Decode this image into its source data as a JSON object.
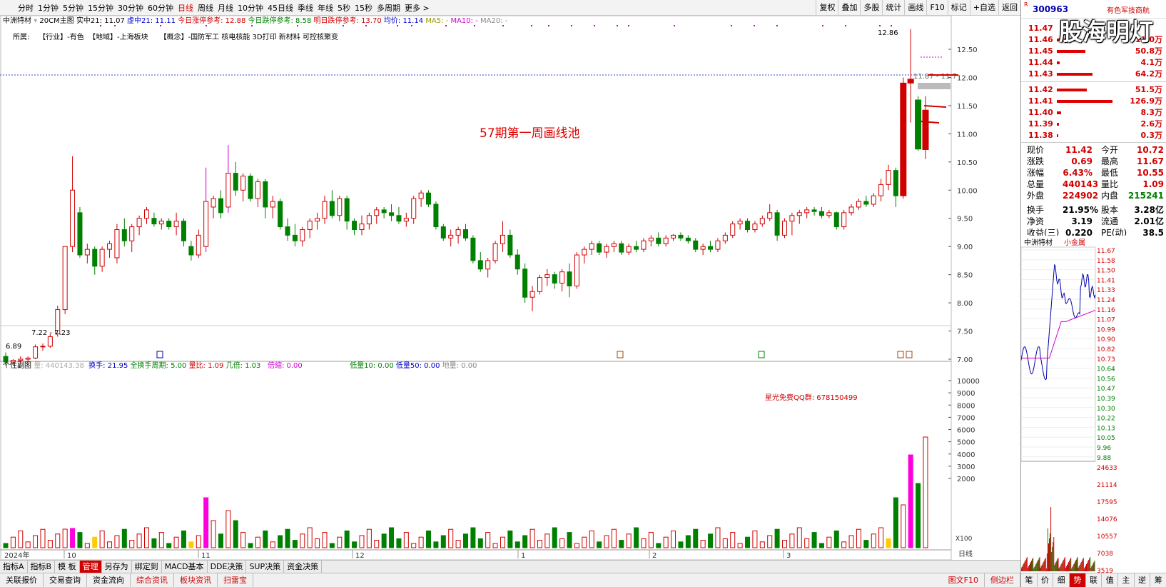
{
  "toolbar": {
    "periods": [
      "分时",
      "1分钟",
      "5分钟",
      "15分钟",
      "30分钟",
      "60分钟",
      "日线",
      "周线",
      "月线",
      "10分钟",
      "45日线",
      "季线",
      "年线",
      "5秒",
      "15秒",
      "多周期",
      "更多 >"
    ],
    "active_period": "日线",
    "tools": [
      "复权",
      "叠加",
      "多股",
      "统计",
      "画线",
      "F10",
      "标记",
      "+自选",
      "返回"
    ]
  },
  "stock": {
    "name": "中洲特材",
    "code": "300963",
    "subtitle": "有色军技商航",
    "board": "20CM主图"
  },
  "info": {
    "realtime": "实中21: 11.07",
    "virtual": "虚中21: 11.11",
    "limit_up_ref": "今日涨停参考: 12.88",
    "limit_down_ref": "今日跌停参考: 8.58",
    "tomorrow_ref": "明日跌停参考: 13.70",
    "avg": "均价: 11.14",
    "ma5": "MA5: -",
    "ma10": "MA10: -",
    "ma20": "MA20: -"
  },
  "tags": {
    "prefix": "所属:",
    "industry": "【行业】-有色",
    "region": "【地域】-上海板块",
    "concept": "【概念】-国防军工 核电核能 3D打印 新材料 可控核聚变"
  },
  "annotation": "57期第一周画线池",
  "chart_labels": {
    "high_label": "12.86",
    "low_label": "6.89",
    "range_label": "7.22 - 7.23",
    "current_label": "11.87 - 11.7"
  },
  "price_axis": [
    "12.50",
    "12.00",
    "11.50",
    "11.00",
    "10.50",
    "10.00",
    "9.50",
    "9.00",
    "8.50",
    "8.00",
    "7.50",
    "7.00"
  ],
  "volume_axis": [
    "10000",
    "9000",
    "8000",
    "7000",
    "6000",
    "5000",
    "4000",
    "3000",
    "2000"
  ],
  "sub_header": {
    "title": "个性副图",
    "vol": "量: 440143.38",
    "hs": "换手: 21.95",
    "qhs": "全换手周期: 5.00",
    "lb": "量比: 1.09",
    "jb": "几倍: 1.03",
    "bj": "倍缩: 0.00",
    "dl10": "低量10: 0.00",
    "dl50": "低量50: 0.00",
    "dil": "地量: 0.00"
  },
  "qq_text": "星光免费QQ群: 678150499",
  "x_axis": {
    "year": "2024年",
    "months": [
      "10",
      "11",
      "12",
      "1",
      "2",
      "3"
    ],
    "zoom": "X100",
    "unit": "日线"
  },
  "bottom_tabs": [
    "指标A",
    "指标B",
    "模 板",
    "管理",
    "另存为",
    "绑定到",
    "MACD基本",
    "DDE决策",
    "SUP决策",
    "资金决策"
  ],
  "bottom_tabs_active": "管理",
  "status": [
    "关联报价",
    "交易查询",
    "资金流向",
    "综合资讯",
    "板块资讯",
    "扫雷宝"
  ],
  "status_right": [
    "图文F10",
    "侧边栏"
  ],
  "orderbook": {
    "asks": [
      {
        "p": "11.47",
        "v": "",
        "w": 0
      },
      {
        "p": "11.46",
        "v": "11.0万",
        "w": 30
      },
      {
        "p": "11.45",
        "v": "50.8万",
        "w": 40
      },
      {
        "p": "11.44",
        "v": "4.1万",
        "w": 4
      },
      {
        "p": "11.43",
        "v": "64.2万",
        "w": 50
      }
    ],
    "bids": [
      {
        "p": "11.42",
        "v": "51.5万",
        "w": 42
      },
      {
        "p": "11.41",
        "v": "126.9万",
        "w": 78
      },
      {
        "p": "11.40",
        "v": "8.3万",
        "w": 6
      },
      {
        "p": "11.39",
        "v": "2.6万",
        "w": 3
      },
      {
        "p": "11.38",
        "v": "0.3万",
        "w": 2
      }
    ]
  },
  "quote": [
    [
      "现价",
      "11.42",
      "red",
      "今开",
      "10.72",
      "red"
    ],
    [
      "涨跌",
      "0.69",
      "red",
      "最高",
      "11.67",
      "red"
    ],
    [
      "涨幅",
      "6.43%",
      "red",
      "最低",
      "10.55",
      "red"
    ],
    [
      "总量",
      "440143",
      "red",
      "量比",
      "1.09",
      "red"
    ],
    [
      "外盘",
      "224902",
      "red",
      "内盘",
      "215241",
      "green"
    ],
    [
      "换手",
      "21.95%",
      "blk",
      "股本",
      "3.28亿",
      "blk"
    ],
    [
      "净资",
      "3.19",
      "blk",
      "流通",
      "2.01亿",
      "blk"
    ],
    [
      "收益(三)",
      "0.220",
      "blk",
      "PE(动)",
      "38.5",
      "blk"
    ]
  ],
  "mini_title": "小金属",
  "mini_axis": [
    "11.67",
    "11.58",
    "11.50",
    "11.41",
    "11.33",
    "11.24",
    "11.16",
    "11.07",
    "10.99",
    "10.90",
    "10.82",
    "10.73",
    "10.64",
    "10.56",
    "10.47",
    "10.39",
    "10.30",
    "10.22",
    "10.13",
    "10.05",
    "9.96",
    "9.88"
  ],
  "mini_vol_axis": [
    "24633",
    "21114",
    "17595",
    "14076",
    "10557",
    "7038",
    "3519"
  ],
  "right_tabs": [
    "笔",
    "价",
    "细",
    "势",
    "联",
    "值",
    "主",
    "逆",
    "筹"
  ],
  "right_tabs_active": "势",
  "watermark": "股海明灯",
  "chart_data": {
    "type": "candlestick",
    "candles": [
      [
        7.05,
        7.12,
        6.89,
        6.95
      ],
      [
        6.95,
        7.0,
        6.9,
        6.98
      ],
      [
        6.98,
        7.05,
        6.92,
        7.0
      ],
      [
        7.0,
        7.05,
        6.95,
        7.02
      ],
      [
        7.02,
        7.26,
        7.0,
        7.22
      ],
      [
        7.22,
        7.28,
        7.15,
        7.23
      ],
      [
        7.23,
        7.45,
        7.2,
        7.4
      ],
      [
        7.45,
        7.95,
        7.4,
        7.88
      ],
      [
        7.88,
        9.0,
        7.8,
        9.0
      ],
      [
        9.0,
        10.6,
        8.9,
        10.0
      ],
      [
        9.6,
        9.7,
        8.8,
        8.85
      ],
      [
        8.85,
        9.05,
        8.7,
        8.95
      ],
      [
        8.95,
        9.0,
        8.5,
        8.65
      ],
      [
        8.65,
        9.0,
        8.55,
        8.95
      ],
      [
        8.95,
        9.1,
        8.8,
        9.05
      ],
      [
        8.8,
        9.4,
        8.7,
        9.3
      ],
      [
        9.3,
        9.5,
        9.0,
        9.1
      ],
      [
        9.1,
        9.4,
        8.9,
        9.35
      ],
      [
        9.35,
        9.55,
        9.2,
        9.5
      ],
      [
        9.5,
        9.7,
        9.4,
        9.65
      ],
      [
        9.5,
        9.6,
        9.35,
        9.4
      ],
      [
        9.4,
        9.5,
        9.3,
        9.45
      ],
      [
        9.45,
        9.5,
        9.3,
        9.35
      ],
      [
        9.35,
        9.6,
        9.2,
        9.45
      ],
      [
        9.45,
        9.5,
        9.0,
        9.1
      ],
      [
        9.0,
        9.1,
        8.75,
        8.85
      ],
      [
        8.85,
        9.3,
        8.8,
        9.2
      ],
      [
        9.0,
        10.4,
        8.9,
        9.8
      ],
      [
        9.7,
        9.9,
        9.5,
        9.85
      ],
      [
        9.85,
        10.0,
        9.5,
        9.6
      ],
      [
        9.7,
        10.8,
        9.6,
        10.3
      ],
      [
        10.3,
        10.5,
        9.9,
        10.0
      ],
      [
        10.0,
        10.3,
        9.8,
        10.25
      ],
      [
        10.25,
        10.3,
        9.8,
        9.85
      ],
      [
        9.85,
        10.2,
        9.7,
        10.15
      ],
      [
        10.15,
        10.2,
        9.5,
        9.7
      ],
      [
        9.7,
        9.9,
        9.5,
        9.8
      ],
      [
        9.8,
        9.85,
        9.3,
        9.35
      ],
      [
        9.35,
        9.5,
        9.1,
        9.2
      ],
      [
        9.2,
        9.4,
        9.0,
        9.1
      ],
      [
        9.1,
        9.35,
        9.0,
        9.3
      ],
      [
        9.3,
        9.5,
        9.15,
        9.45
      ],
      [
        9.45,
        9.6,
        9.3,
        9.5
      ],
      [
        9.5,
        9.9,
        9.4,
        9.8
      ],
      [
        9.8,
        10.0,
        9.5,
        9.55
      ],
      [
        9.55,
        9.9,
        9.45,
        9.85
      ],
      [
        9.85,
        9.9,
        9.3,
        9.45
      ],
      [
        9.45,
        9.5,
        9.2,
        9.3
      ],
      [
        9.3,
        9.55,
        9.2,
        9.4
      ],
      [
        9.4,
        9.6,
        9.3,
        9.55
      ],
      [
        9.55,
        9.7,
        9.4,
        9.65
      ],
      [
        9.65,
        9.7,
        9.5,
        9.6
      ],
      [
        9.6,
        9.75,
        9.45,
        9.55
      ],
      [
        9.55,
        9.7,
        9.4,
        9.45
      ],
      [
        9.45,
        9.6,
        9.35,
        9.5
      ],
      [
        9.5,
        9.9,
        9.4,
        9.85
      ],
      [
        9.85,
        10.0,
        9.7,
        9.95
      ],
      [
        9.95,
        10.0,
        9.7,
        9.75
      ],
      [
        9.75,
        9.8,
        9.3,
        9.35
      ],
      [
        9.35,
        9.4,
        9.1,
        9.15
      ],
      [
        9.15,
        9.3,
        9.0,
        9.2
      ],
      [
        9.2,
        9.35,
        9.05,
        9.3
      ],
      [
        9.3,
        9.4,
        9.1,
        9.15
      ],
      [
        9.15,
        9.2,
        8.7,
        8.75
      ],
      [
        8.75,
        8.9,
        8.55,
        8.6
      ],
      [
        8.6,
        8.8,
        8.45,
        8.75
      ],
      [
        8.75,
        9.1,
        8.7,
        9.05
      ],
      [
        9.05,
        9.45,
        8.9,
        9.2
      ],
      [
        9.2,
        9.3,
        8.8,
        8.85
      ],
      [
        8.85,
        8.95,
        8.5,
        8.6
      ],
      [
        8.6,
        8.7,
        8.0,
        8.1
      ],
      [
        8.1,
        8.3,
        7.85,
        8.2
      ],
      [
        8.2,
        8.5,
        8.15,
        8.45
      ],
      [
        8.45,
        8.6,
        8.3,
        8.5
      ],
      [
        8.5,
        8.55,
        8.25,
        8.35
      ],
      [
        8.35,
        8.6,
        8.2,
        8.55
      ],
      [
        8.55,
        8.7,
        8.1,
        8.3
      ],
      [
        8.3,
        8.9,
        8.25,
        8.85
      ],
      [
        8.85,
        9.0,
        8.7,
        8.95
      ],
      [
        8.95,
        9.1,
        8.85,
        9.05
      ],
      [
        9.05,
        9.1,
        8.85,
        8.9
      ],
      [
        8.9,
        9.05,
        8.8,
        9.0
      ],
      [
        9.0,
        9.1,
        8.9,
        9.05
      ],
      [
        9.05,
        9.1,
        8.85,
        8.9
      ],
      [
        8.9,
        9.05,
        8.85,
        9.0
      ],
      [
        9.0,
        9.1,
        8.9,
        8.95
      ],
      [
        8.95,
        9.15,
        8.9,
        9.1
      ],
      [
        9.1,
        9.2,
        9.0,
        9.15
      ],
      [
        9.15,
        9.25,
        9.0,
        9.05
      ],
      [
        9.05,
        9.2,
        9.0,
        9.15
      ],
      [
        9.15,
        9.22,
        9.1,
        9.2
      ],
      [
        9.2,
        9.25,
        9.1,
        9.15
      ],
      [
        9.15,
        9.2,
        9.05,
        9.1
      ],
      [
        9.1,
        9.15,
        8.9,
        8.95
      ],
      [
        8.95,
        9.05,
        8.85,
        9.0
      ],
      [
        9.0,
        9.1,
        8.9,
        8.95
      ],
      [
        8.95,
        9.15,
        8.9,
        9.1
      ],
      [
        9.1,
        9.25,
        9.05,
        9.2
      ],
      [
        9.2,
        9.45,
        9.15,
        9.4
      ],
      [
        9.4,
        9.5,
        9.3,
        9.45
      ],
      [
        9.45,
        9.5,
        9.25,
        9.3
      ],
      [
        9.3,
        9.45,
        9.25,
        9.4
      ],
      [
        9.4,
        9.55,
        9.35,
        9.5
      ],
      [
        9.5,
        9.75,
        9.45,
        9.6
      ],
      [
        9.6,
        9.65,
        9.1,
        9.2
      ],
      [
        9.2,
        9.5,
        9.15,
        9.45
      ],
      [
        9.45,
        9.6,
        9.2,
        9.55
      ],
      [
        9.55,
        9.65,
        9.4,
        9.6
      ],
      [
        9.6,
        9.7,
        9.5,
        9.65
      ],
      [
        9.65,
        9.7,
        9.55,
        9.62
      ],
      [
        9.62,
        9.7,
        9.5,
        9.55
      ],
      [
        9.55,
        9.65,
        9.5,
        9.6
      ],
      [
        9.6,
        9.62,
        9.3,
        9.35
      ],
      [
        9.35,
        9.65,
        9.3,
        9.6
      ],
      [
        9.6,
        9.75,
        9.55,
        9.7
      ],
      [
        9.7,
        9.85,
        9.65,
        9.8
      ],
      [
        9.8,
        9.9,
        9.7,
        9.75
      ],
      [
        9.75,
        9.95,
        9.7,
        9.9
      ],
      [
        9.9,
        10.2,
        9.8,
        10.1
      ],
      [
        10.1,
        10.45,
        10.0,
        10.35
      ],
      [
        10.35,
        10.4,
        9.7,
        9.9
      ],
      [
        9.9,
        12.0,
        9.85,
        11.9
      ],
      [
        11.9,
        12.86,
        11.2,
        11.97
      ],
      [
        11.6,
        11.67,
        10.7,
        10.73
      ],
      [
        10.72,
        11.67,
        10.55,
        11.42
      ]
    ]
  }
}
